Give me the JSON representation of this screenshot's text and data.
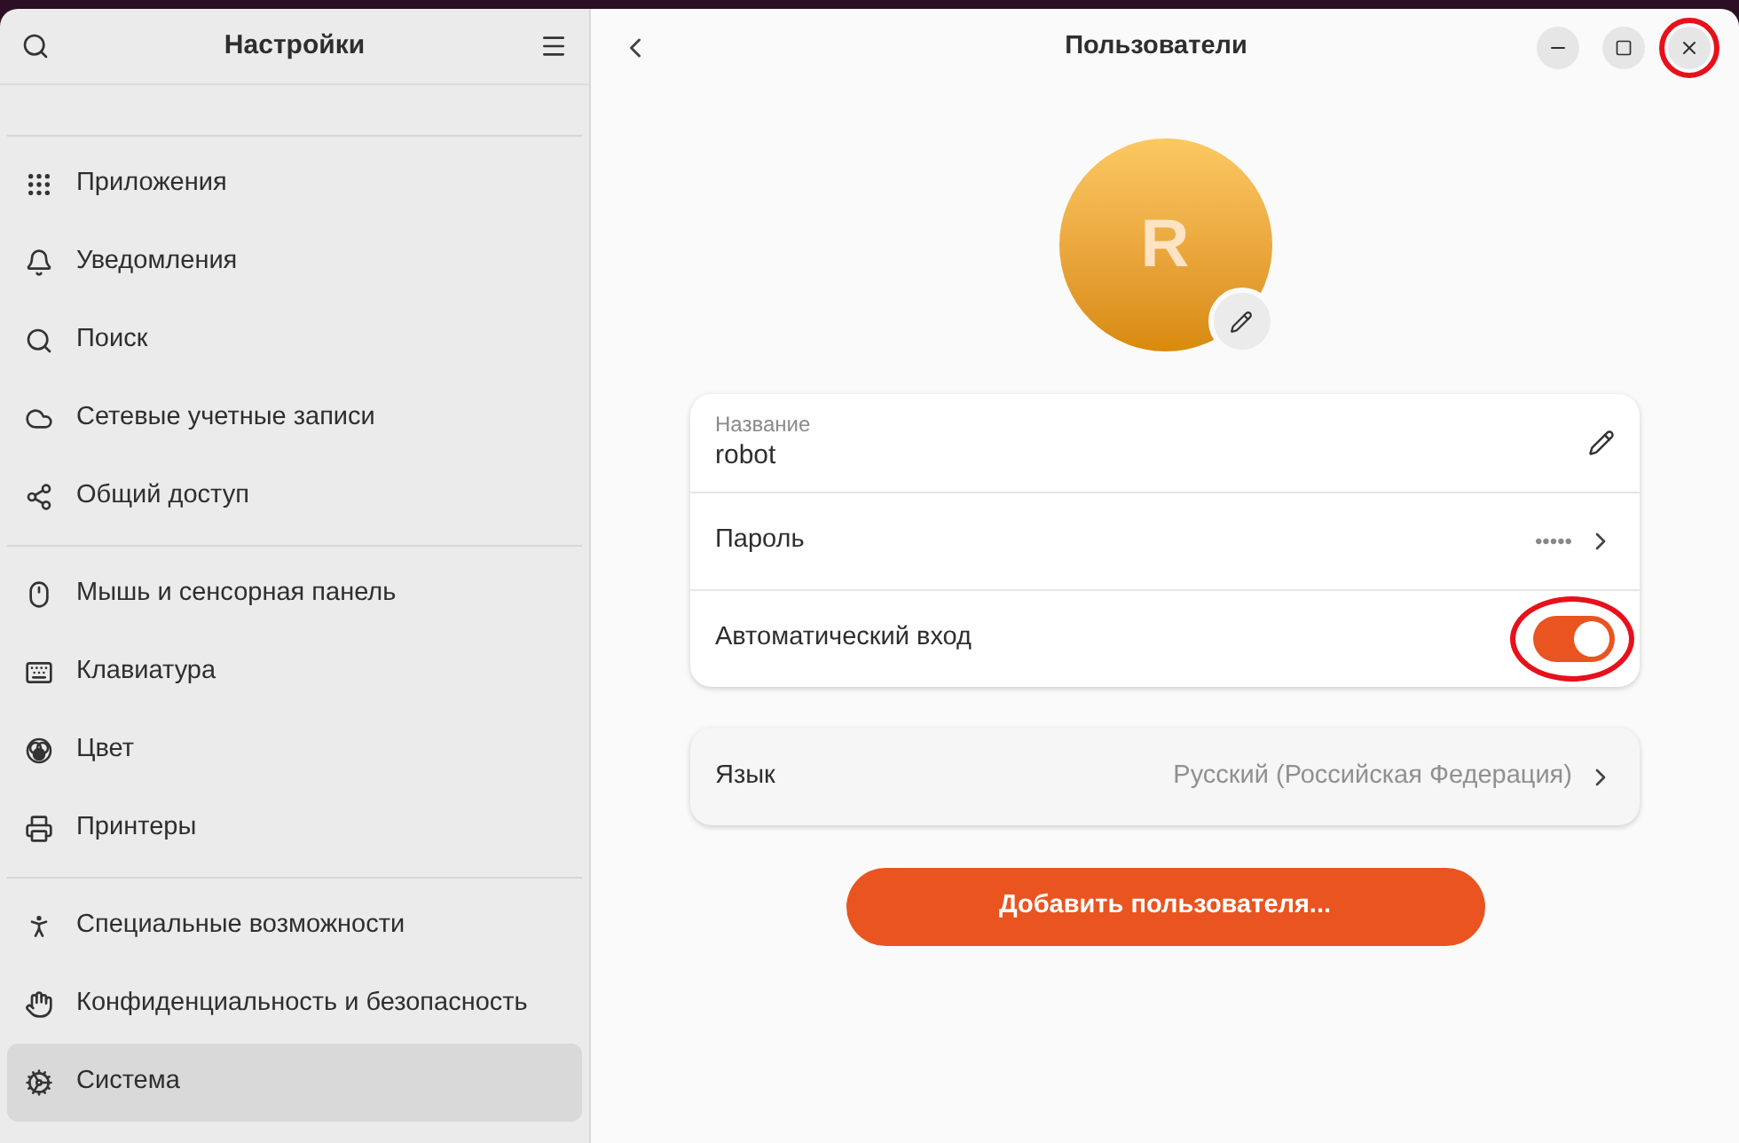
{
  "sidebar": {
    "title": "Настройки",
    "groups": [
      [
        {
          "label": "Приложения",
          "selected": false
        },
        {
          "label": "Уведомления",
          "selected": false
        },
        {
          "label": "Поиск",
          "selected": false
        },
        {
          "label": "Сетевые учетные записи",
          "selected": false
        },
        {
          "label": "Общий доступ",
          "selected": false
        }
      ],
      [
        {
          "label": "Мышь и сенсорная панель",
          "selected": false
        },
        {
          "label": "Клавиатура",
          "selected": false
        },
        {
          "label": "Цвет",
          "selected": false
        },
        {
          "label": "Принтеры",
          "selected": false
        }
      ],
      [
        {
          "label": "Специальные возможности",
          "selected": false
        },
        {
          "label": "Конфиденциальность и безопасность",
          "selected": false
        },
        {
          "label": "Система",
          "selected": true
        }
      ]
    ]
  },
  "page": {
    "title": "Пользователи",
    "avatar_letter": "R",
    "account": [
      {
        "kind": "name",
        "label": "Название",
        "value": "robot"
      },
      {
        "kind": "link",
        "label": "Пароль",
        "value": "•••••"
      },
      {
        "kind": "switch",
        "label": "Автоматический вход",
        "on": true
      }
    ],
    "language": {
      "label": "Язык",
      "value": "Русский (Российская Федерация)"
    },
    "add_button": "Добавить пользователя..."
  }
}
